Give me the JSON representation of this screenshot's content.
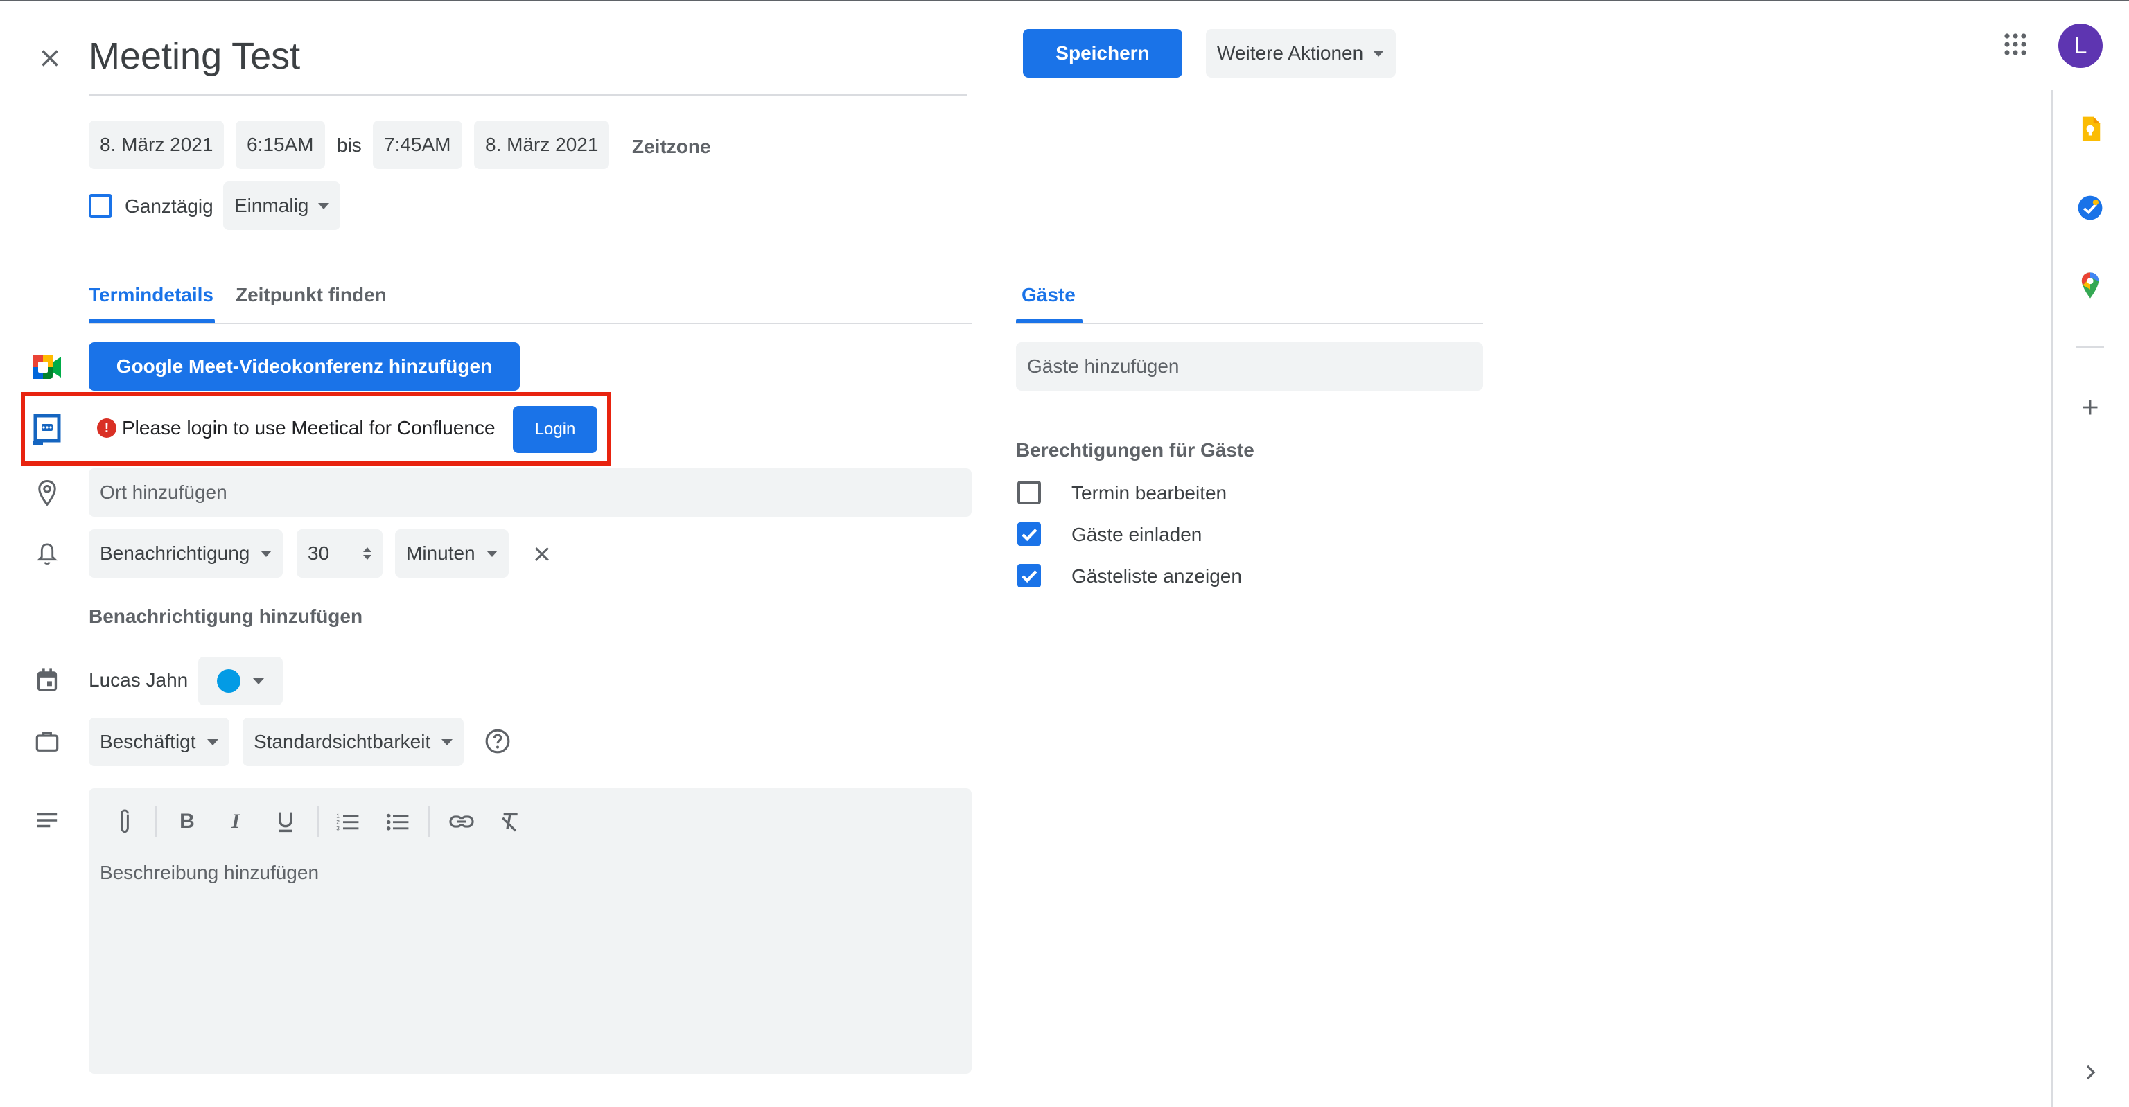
{
  "header": {
    "title": "Meeting Test",
    "save_label": "Speichern",
    "more_actions_label": "Weitere Aktionen",
    "avatar_letter": "L"
  },
  "datetime": {
    "start_date": "8. März 2021",
    "start_time": "6:15AM",
    "to_label": "bis",
    "end_time": "7:45AM",
    "end_date": "8. März 2021",
    "timezone_label": "Zeitzone",
    "all_day_label": "Ganztägig",
    "recurrence": "Einmalig"
  },
  "tabs": {
    "details": "Termindetails",
    "find_time": "Zeitpunkt finden",
    "guests": "Gäste"
  },
  "meet": {
    "add_label": "Google Meet-Videokonferenz hinzufügen"
  },
  "meetical": {
    "message": "Please login to use Meetical for Confluence",
    "login_label": "Login"
  },
  "location": {
    "placeholder": "Ort hinzufügen"
  },
  "notification": {
    "type": "Benachrichtigung",
    "amount": "30",
    "unit": "Minuten",
    "add_label": "Benachrichtigung hinzufügen"
  },
  "calendar": {
    "owner": "Lucas Jahn",
    "color": "#039be5"
  },
  "availability": {
    "status": "Beschäftigt",
    "visibility": "Standardsichtbarkeit"
  },
  "description": {
    "placeholder": "Beschreibung hinzufügen"
  },
  "guests": {
    "add_placeholder": "Gäste hinzufügen",
    "permissions_title": "Berechtigungen für Gäste",
    "permissions": [
      {
        "label": "Termin bearbeiten",
        "checked": false
      },
      {
        "label": "Gäste einladen",
        "checked": true
      },
      {
        "label": "Gästeliste anzeigen",
        "checked": true
      }
    ]
  },
  "colors": {
    "accent": "#1a73e8",
    "highlight_border": "#e8230f",
    "error": "#d93025"
  }
}
